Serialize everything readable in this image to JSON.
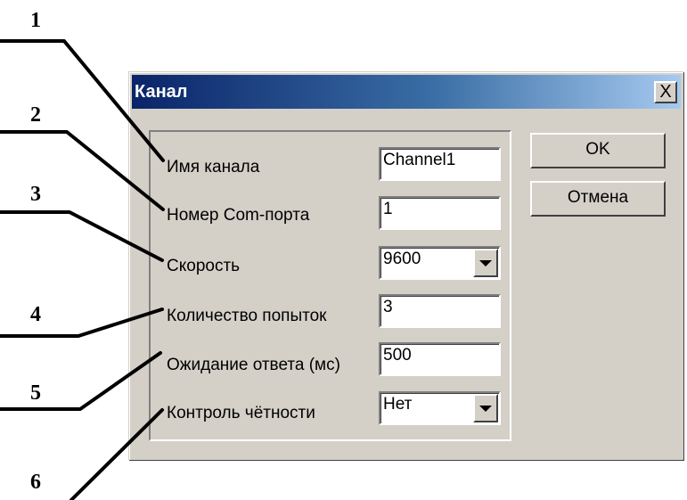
{
  "dialog": {
    "title": "Канал",
    "close_label": "X",
    "fields": [
      {
        "label": "Имя канала",
        "value": "Channel1"
      },
      {
        "label": "Номер Com-порта",
        "value": "1"
      },
      {
        "label": "Скорость",
        "value": "9600"
      },
      {
        "label": "Количество попыток",
        "value": "3"
      },
      {
        "label": "Ожидание ответа (мс)",
        "value": "500"
      },
      {
        "label": "Контроль чётности",
        "value": "Нет"
      }
    ],
    "buttons": {
      "ok": "OK",
      "cancel": "Отмена"
    }
  },
  "callouts": [
    "1",
    "2",
    "3",
    "4",
    "5",
    "6"
  ]
}
